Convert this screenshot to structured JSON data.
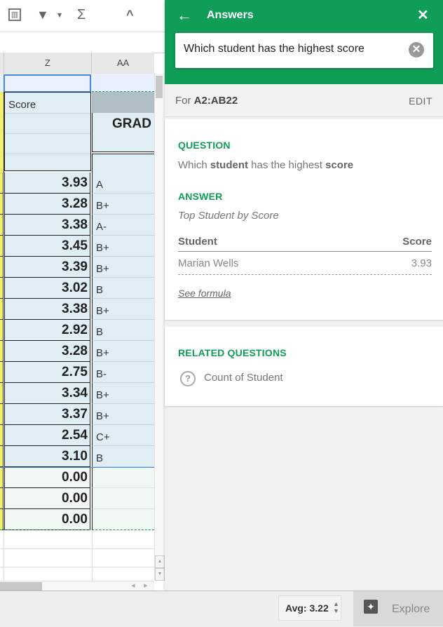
{
  "toolbar": {
    "icons": [
      "chart-icon",
      "filter-icon",
      "dropdown-arrow-icon",
      "functions-icon",
      "collapse-icon"
    ],
    "chart_glyph": "▥",
    "filter_glyph": "▼",
    "dropdown_glyph": "▾",
    "sigma_glyph": "Σ",
    "collapse_glyph": "^"
  },
  "columns": [
    {
      "label": "Z"
    },
    {
      "label": "AA"
    }
  ],
  "sheet": {
    "header_z": "Score",
    "header_aa": "GRAD",
    "rows": [
      {
        "score": "3.93",
        "grade": "A"
      },
      {
        "score": "3.28",
        "grade": "B+"
      },
      {
        "score": "3.38",
        "grade": "A-"
      },
      {
        "score": "3.45",
        "grade": "B+"
      },
      {
        "score": "3.39",
        "grade": "B+"
      },
      {
        "score": "3.02",
        "grade": "B"
      },
      {
        "score": "3.38",
        "grade": "B+"
      },
      {
        "score": "2.92",
        "grade": "B"
      },
      {
        "score": "3.28",
        "grade": "B+"
      },
      {
        "score": "2.75",
        "grade": "B-"
      },
      {
        "score": "3.34",
        "grade": "B+"
      },
      {
        "score": "3.37",
        "grade": "B+"
      },
      {
        "score": "2.54",
        "grade": "C+"
      },
      {
        "score": "3.10",
        "grade": "B"
      },
      {
        "score": "0.00",
        "grade": ""
      },
      {
        "score": "0.00",
        "grade": ""
      },
      {
        "score": "0.00",
        "grade": ""
      }
    ]
  },
  "panel": {
    "title": "Answers",
    "back_glyph": "←",
    "close_glyph": "✕",
    "search_value": "Which student has the highest score",
    "clear_glyph": "✕",
    "range_prefix": "For",
    "range_value": "A2:AB22",
    "edit_label": "EDIT",
    "question_title": "QUESTION",
    "question_parts": [
      "Which ",
      "student",
      " has the highest ",
      "score"
    ],
    "answer_title": "ANSWER",
    "answer_subtitle": "Top Student by Score",
    "answer_table": {
      "headers": [
        "Student",
        "Score"
      ],
      "rows": [
        [
          "Marian Wells",
          "3.93"
        ]
      ]
    },
    "see_formula": "See formula",
    "related_title": "RELATED QUESTIONS",
    "related": [
      {
        "label": "Count of Student",
        "icon": "help-icon",
        "glyph": "?"
      }
    ]
  },
  "status": {
    "avg_label": "Avg: 3.22",
    "avg_arrows": "▲\n▼",
    "explore_label": "Explore",
    "explore_glyph": "✦"
  }
}
